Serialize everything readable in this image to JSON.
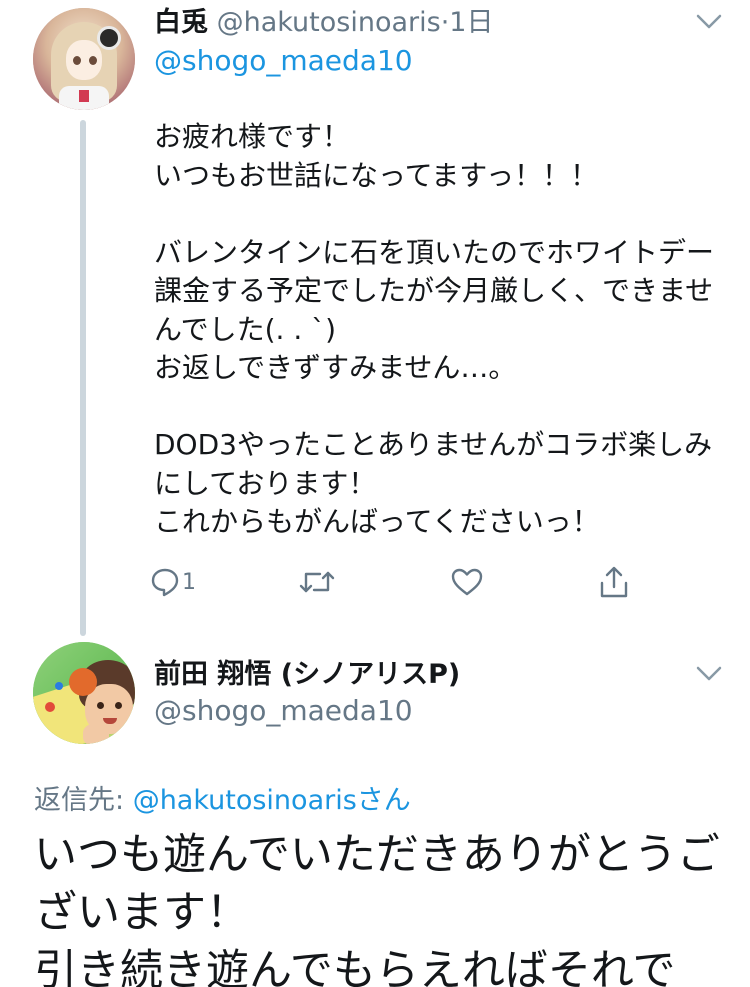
{
  "tweet1": {
    "display_name": "白兎",
    "handle": "@hakutosinoaris",
    "separator": "·",
    "time": "1日",
    "replying_handle": "@shogo_maeda10",
    "text": "お疲れ様です！\nいつもお世話になってますっ！！！\n\nバレンタインに石を頂いたのでホワイトデー課金する予定でしたが今月厳しく、できませんでした(. . `)\nお返しできずすみません…。\n\nDOD3やったことありませんがコラボ楽しみにしております！\nこれからもがんばってくださいっ！",
    "reply_count": "1",
    "icons": {
      "avatar": "anime-girl-avatar",
      "menu": "chevron-down-icon",
      "reply": "reply-icon",
      "retweet": "retweet-icon",
      "like": "heart-icon",
      "share": "share-icon"
    }
  },
  "tweet2": {
    "display_name": "前田 翔悟 (シノアリスP)",
    "handle": "@shogo_maeda10",
    "replying_label": "返信先: ",
    "replying_mention": "@hakutosinoarisさん",
    "text": "いつも遊んでいただきありがとうございます！\n引き続き遊んでもらえればそれで"
  },
  "colors": {
    "link": "#1b95e0",
    "secondary_text": "#657786",
    "primary_text": "#14171a",
    "thread_line": "#ccd6dd"
  }
}
